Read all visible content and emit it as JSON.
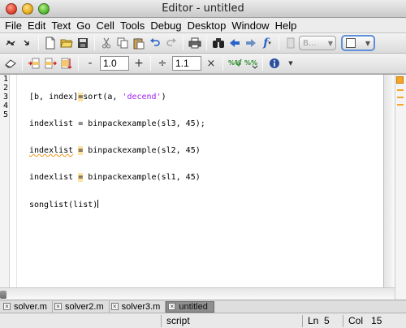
{
  "window": {
    "title": "Editor - untitled"
  },
  "menu": [
    "File",
    "Edit",
    "Text",
    "Go",
    "Cell",
    "Tools",
    "Debug",
    "Desktop",
    "Window",
    "Help"
  ],
  "toolbar1": {
    "stack_dropdown_label": "B...",
    "function_label": "f"
  },
  "toolbar2": {
    "step_value_1": "1.0",
    "step_value_2": "1.1",
    "minus": "-",
    "plus": "+",
    "divide": "÷",
    "times": "×"
  },
  "editor": {
    "line_numbers": [
      "1",
      "2",
      "3",
      "4",
      "5"
    ],
    "lines": [
      "[b, index]=sort(a, 'decend')",
      "indexlist = binpackexample(sl3, 45);",
      "indexlist = binpackexample(sl2, 45)",
      "indexlist = binpackexample(sl1, 45)",
      "songlist(list)"
    ],
    "string_literal": "'decend'"
  },
  "tabs": [
    {
      "label": "solver.m",
      "active": false
    },
    {
      "label": "solver2.m",
      "active": false
    },
    {
      "label": "solver3.m",
      "active": false
    },
    {
      "label": "untitled",
      "active": true
    }
  ],
  "status": {
    "mode": "script",
    "line_label": "Ln",
    "line_value": "5",
    "col_label": "Col",
    "col_value": "15"
  },
  "colors": {
    "warning": "#f5a623",
    "string": "#a020f0",
    "accent": "#2a63c8"
  }
}
